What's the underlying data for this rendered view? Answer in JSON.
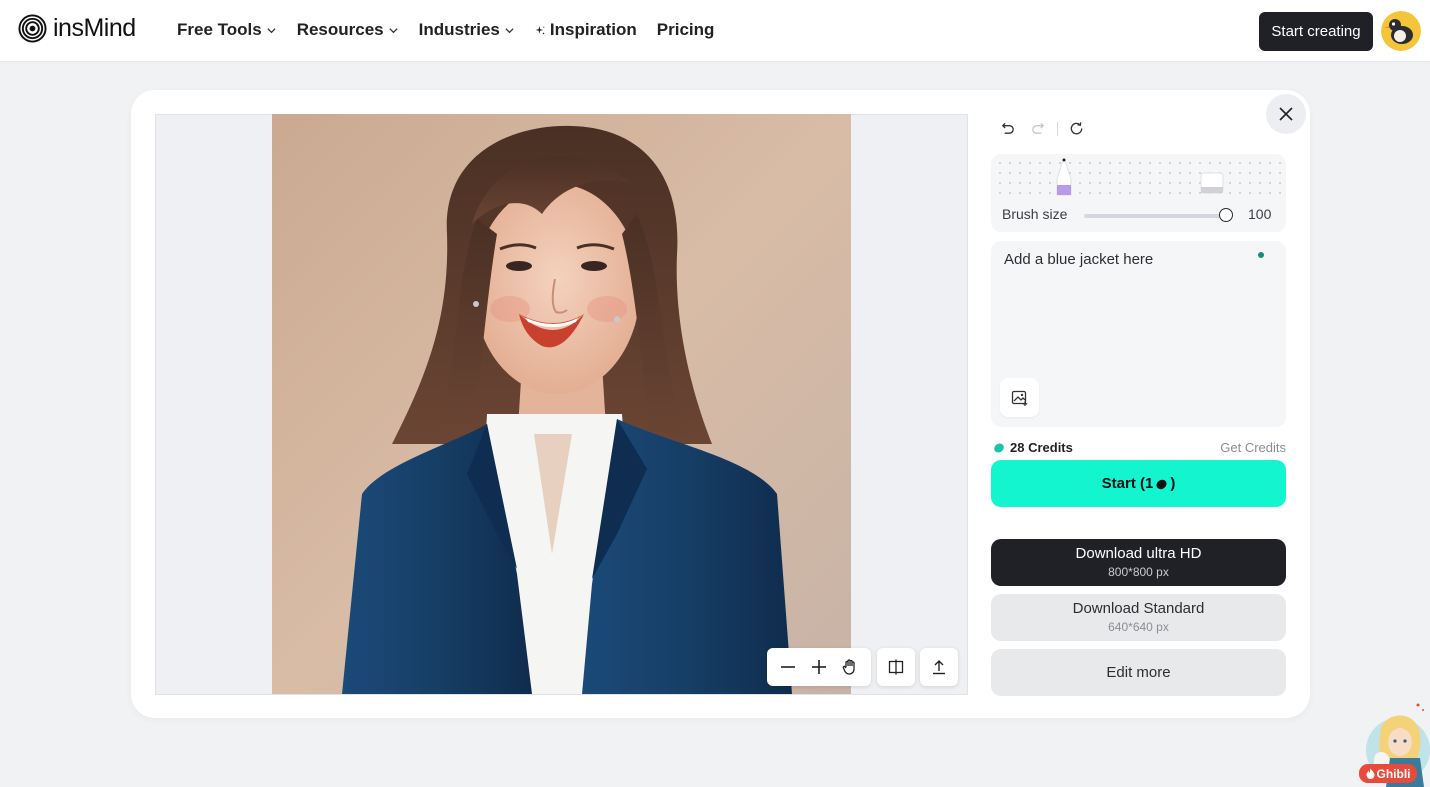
{
  "brand": {
    "name": "insMind"
  },
  "nav": {
    "items": [
      {
        "label": "Free Tools",
        "has_dropdown": true
      },
      {
        "label": "Resources",
        "has_dropdown": true
      },
      {
        "label": "Industries",
        "has_dropdown": true
      },
      {
        "label": "Inspiration",
        "icon": "sparkle-icon"
      },
      {
        "label": "Pricing"
      }
    ],
    "cta_label": "Start creating"
  },
  "editor": {
    "brush": {
      "label": "Brush size",
      "value": "100",
      "fraction": 1.0
    },
    "prompt": {
      "value": "Add a blue jacket here"
    },
    "credits": {
      "label": "28 Credits",
      "get_label": "Get Credits"
    },
    "start": {
      "label_prefix": "Start (1",
      "label_suffix": ")"
    },
    "download_hd": {
      "title": "Download ultra HD",
      "size": "800*800 px"
    },
    "download_standard": {
      "title": "Download Standard",
      "size": "640*640 px"
    },
    "edit_more": {
      "label": "Edit more"
    }
  },
  "promo": {
    "badge": "Ghibli"
  },
  "colors": {
    "accent": "#12f5cf",
    "dark": "#1f2127",
    "panel_bg": "#ffffff",
    "page_bg": "#f1f2f4",
    "jacket": "#163e66"
  }
}
